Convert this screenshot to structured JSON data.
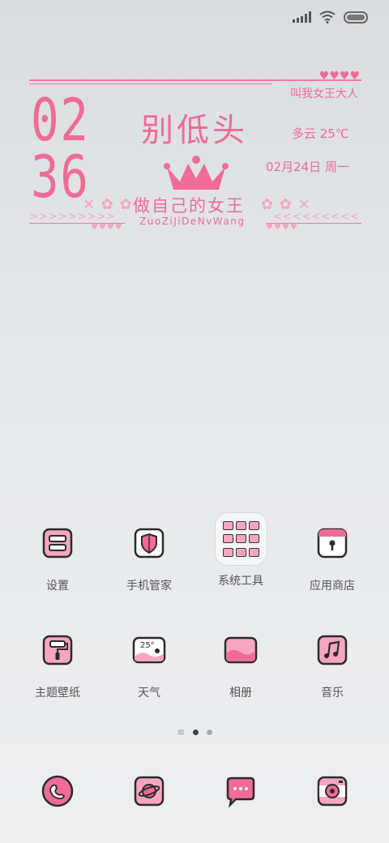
{
  "status": {
    "icons": [
      "signal-icon",
      "wifi-icon",
      "battery-icon"
    ]
  },
  "widget": {
    "tagline": "叫我女王大人",
    "hearts_top": "♥♥♥♥",
    "hour": "02",
    "minute": "36",
    "headline": "别低头",
    "weather": "多云   25℃",
    "date": "02月24日  周一",
    "slogan": "做自己的女王",
    "slogan_pinyin": "ZuoZiJiDeNvWang",
    "left_arrows": ">>>>>>>>>",
    "right_arrows": "<<<<<<<<<",
    "hearts_left": "♥♥♥♥",
    "hearts_right": "♥♥♥♥"
  },
  "apps_row1": [
    {
      "label": "设置",
      "icon": "settings-icon"
    },
    {
      "label": "手机管家",
      "icon": "security-shield-icon"
    },
    {
      "label": "系统工具",
      "icon": "folder-icon"
    },
    {
      "label": "应用商店",
      "icon": "app-store-icon"
    }
  ],
  "apps_row2": [
    {
      "label": "主题壁纸",
      "icon": "theme-brush-icon"
    },
    {
      "label": "天气",
      "icon": "weather-icon",
      "temp": "25°"
    },
    {
      "label": "相册",
      "icon": "gallery-icon"
    },
    {
      "label": "音乐",
      "icon": "music-icon"
    }
  ],
  "dock": [
    {
      "icon": "phone-icon"
    },
    {
      "icon": "browser-planet-icon"
    },
    {
      "icon": "messages-icon"
    },
    {
      "icon": "camera-icon"
    }
  ],
  "colors": {
    "accent": "#f06c96",
    "icon_fill": "#f6a6c0",
    "stroke": "#2b2b2b"
  }
}
